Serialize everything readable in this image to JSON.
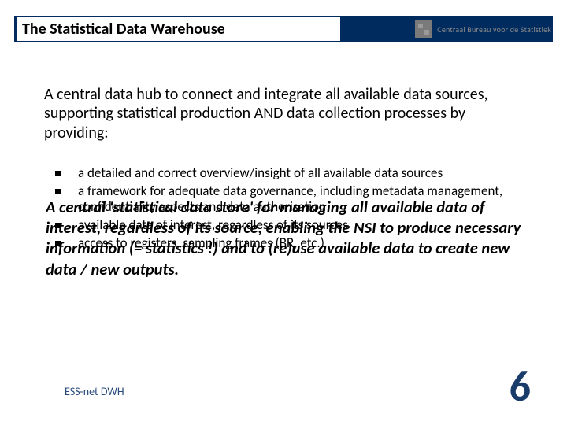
{
  "header": {
    "title": "The Statistical  Data Warehouse",
    "brand": "Centraal Bureau voor de Statistiek"
  },
  "intro": "A central data hub to connect and integrate all available data sources, supporting statistical production AND data collection processes by providing:",
  "bullets": [
    "a detailed and correct overview/insight of all available data sources",
    "a framework for adequate data governance, including metadata management, confidentiality aspects and data authorisation",
    "available data of interest, regardless of its sources",
    "access to registers, sampling frames (BR, etc.)"
  ],
  "overlay": "A central 'statistical data store' for managing all available data of interest, regardless of its source, enabling the NSI to produce necessary information (= statistics  !) and to  (re)use available data to create new data / new outputs.",
  "footer": {
    "label": "ESS-net DWH",
    "page": "6"
  }
}
